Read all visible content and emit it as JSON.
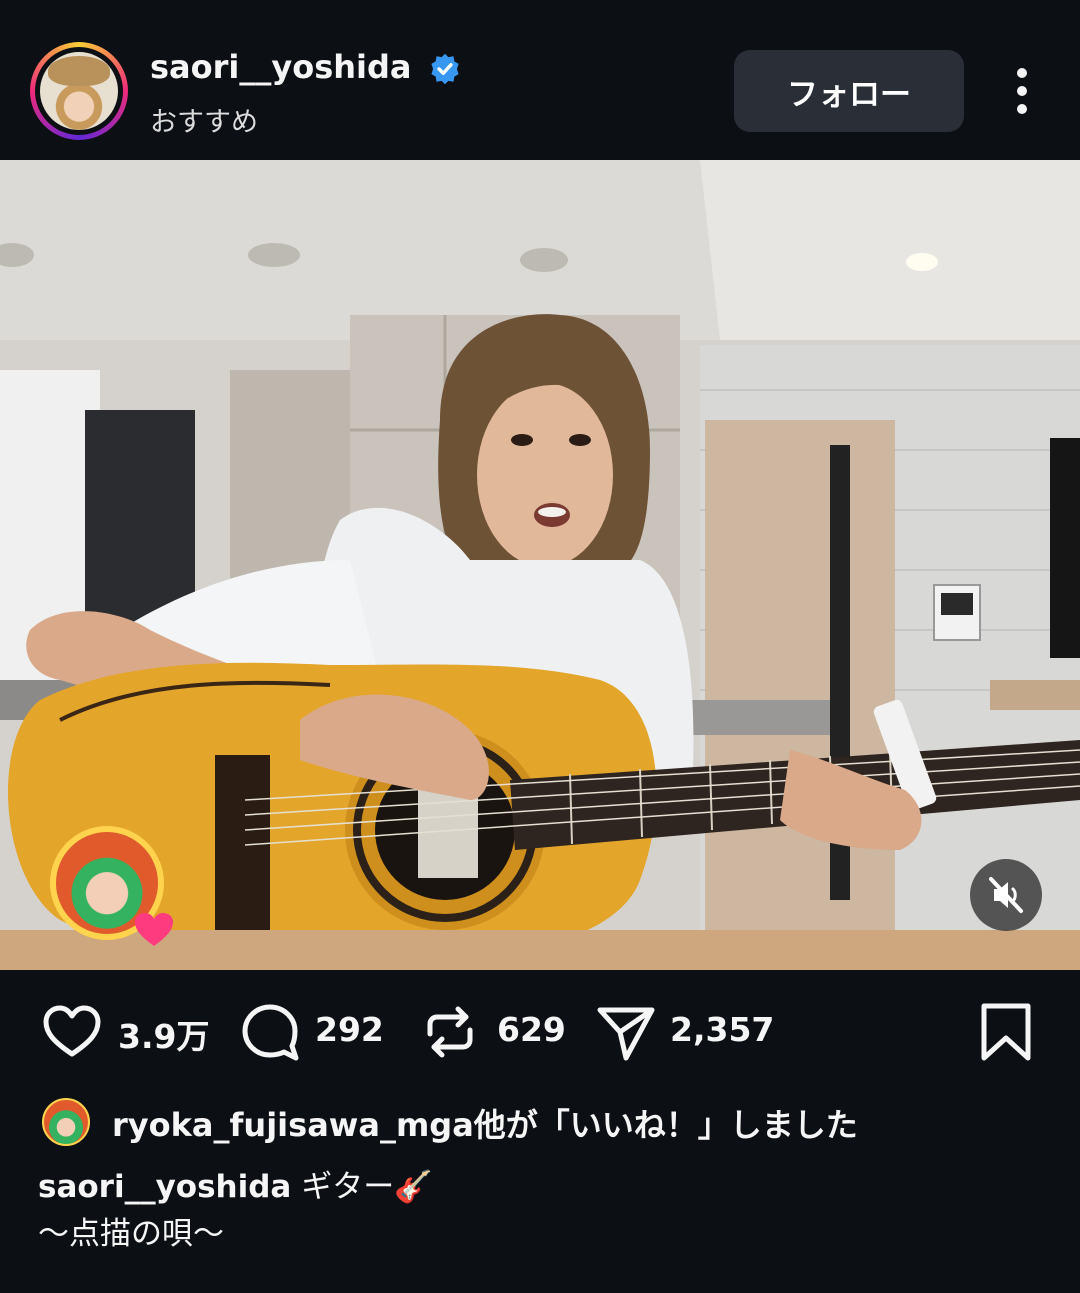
{
  "header": {
    "username": "saori__yoshida",
    "subtitle": "おすすめ",
    "follow_label": "フォロー",
    "verified_color": "#3897f0"
  },
  "media": {
    "type": "video",
    "muted": true,
    "description_icon": "mute-icon"
  },
  "actions": {
    "likes": "3.9万",
    "comments": "292",
    "reposts": "629",
    "shares": "2,357"
  },
  "liked_by": {
    "text": "ryoka_fujisawa_mga他が「いいね！」しました"
  },
  "caption": {
    "username": "saori__yoshida",
    "text": "ギター🎸",
    "line2": "〜点描の唄〜"
  },
  "colors": {
    "background": "#0c0f14",
    "follow_button": "#2a2f37",
    "heart_pink": "#ff3b7f"
  }
}
